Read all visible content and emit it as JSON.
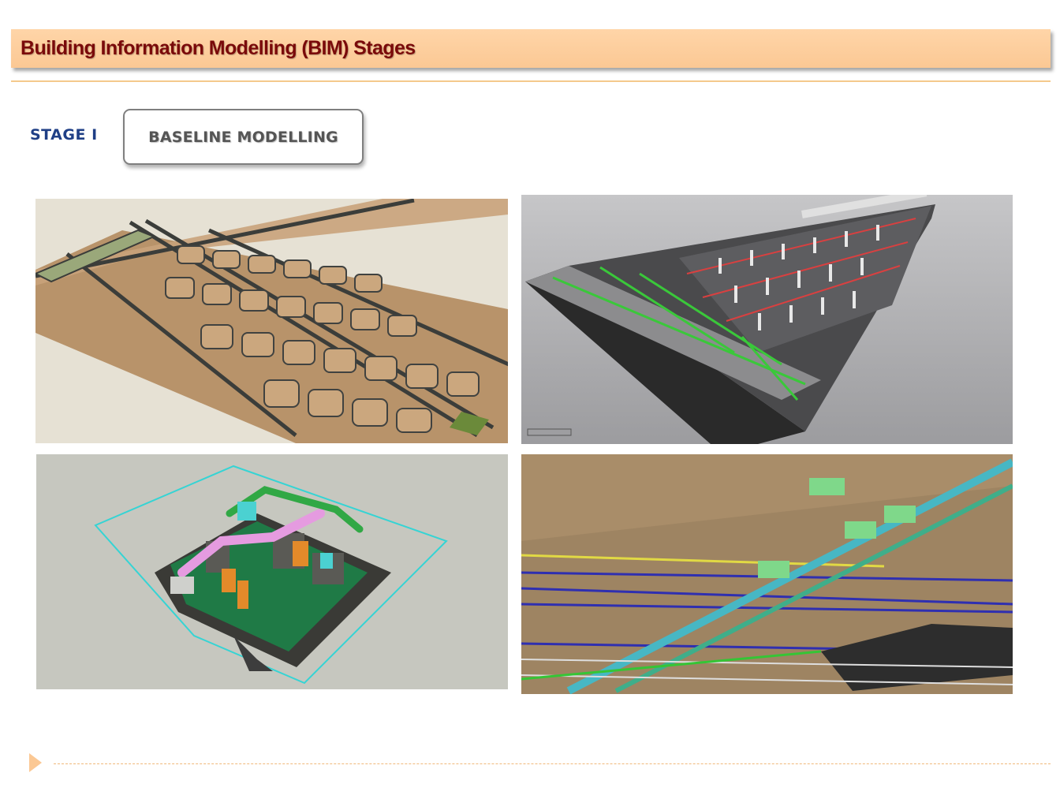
{
  "slide": {
    "title": "Building Information Modelling (BIM) Stages",
    "stage_label": "STAGE I",
    "stage_name": "BASELINE MODELLING"
  },
  "images": [
    {
      "name": "site-road-masterplan-model",
      "depicts": "3D road and block layout model of a site"
    },
    {
      "name": "station-structure-model",
      "depicts": "3D structural model of a long elevated station building"
    },
    {
      "name": "plant-room-mep-model",
      "depicts": "3D model of a plant room with coloured MEP services"
    },
    {
      "name": "ceiling-services-model",
      "depicts": "3D view of ceiling-level pipes, ducts and cable trays"
    }
  ],
  "colors": {
    "title_bar": "#fbc894",
    "title_text": "#7a0a0a",
    "stage_label": "#1f3f86",
    "stage_box_border": "#7f7f7f",
    "stage_box_text": "#555555",
    "footer_accent": "#fbc894"
  }
}
